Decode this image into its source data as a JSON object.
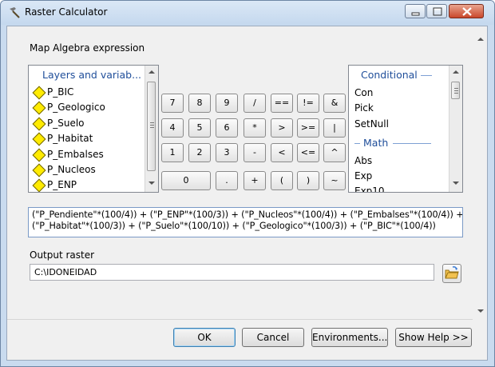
{
  "window": {
    "title": "Raster Calculator",
    "icon": "hammer-icon"
  },
  "expression_label": "Map Algebra expression",
  "layers": {
    "header": "Layers and variab...",
    "items": [
      "P_BIC",
      "P_Geologico",
      "P_Suelo",
      "P_Habitat",
      "P_Embalses",
      "P_Nucleos",
      "P_ENP"
    ]
  },
  "keypad": {
    "row1": [
      "7",
      "8",
      "9",
      "/",
      "==",
      "!=",
      "&"
    ],
    "row2": [
      "4",
      "5",
      "6",
      "*",
      ">",
      ">=",
      "|"
    ],
    "row3": [
      "1",
      "2",
      "3",
      "-",
      "<",
      "<=",
      "^"
    ],
    "row4": [
      "0",
      ".",
      "+",
      "(",
      ")",
      "~"
    ]
  },
  "functions": {
    "header_conditional": "Conditional",
    "conditional": [
      "Con",
      "Pick",
      "SetNull"
    ],
    "header_math": "Math",
    "math": [
      "Abs",
      "Exp",
      "Exp10"
    ]
  },
  "expression": {
    "line1": "(\"P_Pendiente\"*(100/4)) + (\"P_ENP\"*(100/3)) + (\"P_Nucleos\"*(100/4)) + (\"P_Embalses\"*(100/4)) +",
    "line2": "(\"P_Habitat\"*(100/3)) + (\"P_Suelo\"*(100/10)) + (\"P_Geologico\"*(100/3)) + (\"P_BIC\"*(100/4))"
  },
  "output": {
    "label": "Output raster",
    "value": "C:\\IDONEIDAD"
  },
  "buttons": {
    "ok": "OK",
    "cancel": "Cancel",
    "environments": "Environments...",
    "help": "Show Help >>"
  },
  "colors": {
    "list_header": "#1f4e9a",
    "layer_diamond": "#ffeb00",
    "title_bar": "#c9dbef"
  }
}
